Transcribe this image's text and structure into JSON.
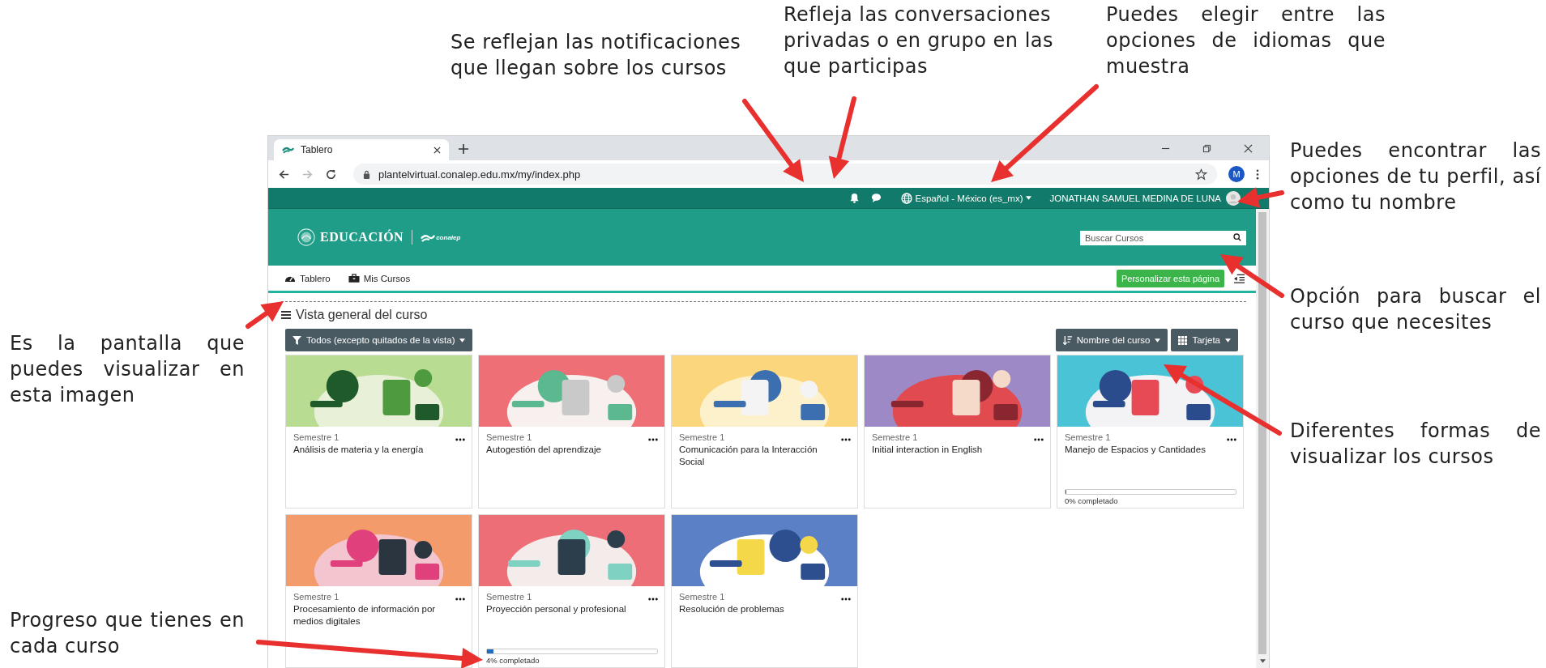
{
  "annotations": [
    {
      "text": "Se reflejan las notificaciones que llegan sobre los cursos"
    },
    {
      "text": "Refleja las conversaciones privadas o en grupo en las que participas"
    },
    {
      "text": "Puedes elegir entre las opciones de idiomas que muestra"
    },
    {
      "text": "Puedes encontrar las opciones de tu perfil, así como tu nombre"
    },
    {
      "text": "Opción para buscar el curso que necesites"
    },
    {
      "text": "Diferentes formas de visualizar los cursos"
    },
    {
      "text": "Es la pantalla que puedes visualizar en esta imagen"
    },
    {
      "text": "Progreso que tienes en cada curso"
    }
  ],
  "browser": {
    "tab_title": "Tablero",
    "url": "plantelvirtual.conalep.edu.mx/my/index.php",
    "profile_initial": "M"
  },
  "top_nav": {
    "language": "Español - México (es_mx)",
    "user_name": "JONATHAN SAMUEL MEDINA DE LUNA"
  },
  "header": {
    "logo_text": "EDUCACIÓN",
    "partner_logo_text": "conalep",
    "search": {
      "placeholder": "Buscar Cursos"
    }
  },
  "nav": {
    "items": [
      {
        "label": "Tablero"
      },
      {
        "label": "Mis Cursos"
      }
    ],
    "customize_button": "Personalizar esta página"
  },
  "course_overview": {
    "title": "Vista general del curso",
    "filter": "Todos (excepto quitados de la vista)",
    "sort": "Nombre del curso",
    "view": "Tarjeta",
    "courses": [
      {
        "semester": "Semestre 1",
        "title": "Análisis de materia y la energía"
      },
      {
        "semester": "Semestre 1",
        "title": "Autogestión del aprendizaje"
      },
      {
        "semester": "Semestre 1",
        "title": "Comunicación para la Interacción Social"
      },
      {
        "semester": "Semestre 1",
        "title": "Initial interaction in English"
      },
      {
        "semester": "Semestre 1",
        "title": "Manejo de Espacios y Cantidades",
        "progress": {
          "level": 0,
          "text": "0% completado"
        }
      },
      {
        "semester": "Semestre 1",
        "title": "Procesamiento de información por medios digitales"
      },
      {
        "semester": "Semestre 1",
        "title": "Proyección personal y profesional",
        "progress": {
          "level": 0.04,
          "text": "4% completado"
        }
      },
      {
        "semester": "Semestre 1",
        "title": "Resolución de problemas"
      }
    ]
  }
}
